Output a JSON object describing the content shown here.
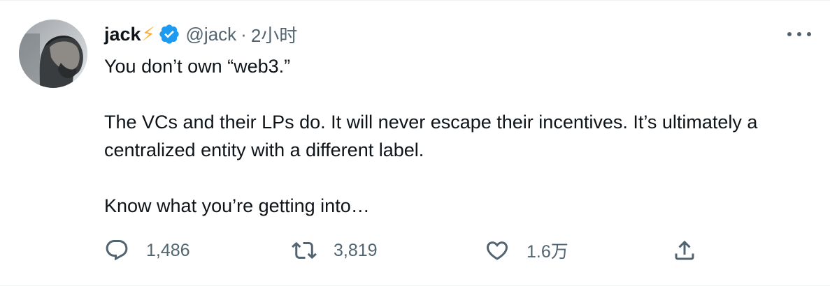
{
  "tweet": {
    "display_name": "jack",
    "name_emoji": "⚡",
    "handle": "@jack",
    "separator": "·",
    "time": "2小时",
    "body": [
      "You don’t own “web3.”",
      "The VCs and their LPs do. It will never escape their incentives. It’s ultimately a centralized entity with a different label.",
      "Know what you’re getting into…"
    ],
    "actions": {
      "reply_count": "1,486",
      "retweet_count": "3,819",
      "like_count": "1.6万"
    }
  },
  "colors": {
    "verified_blue": "#1d9bf0",
    "secondary_text": "#536471",
    "bolt": "#ffac33"
  },
  "icons": {
    "reply": "reply-icon",
    "retweet": "retweet-icon",
    "like": "heart-icon",
    "share": "share-icon",
    "more": "more-icon",
    "verified": "verified-badge-icon"
  }
}
